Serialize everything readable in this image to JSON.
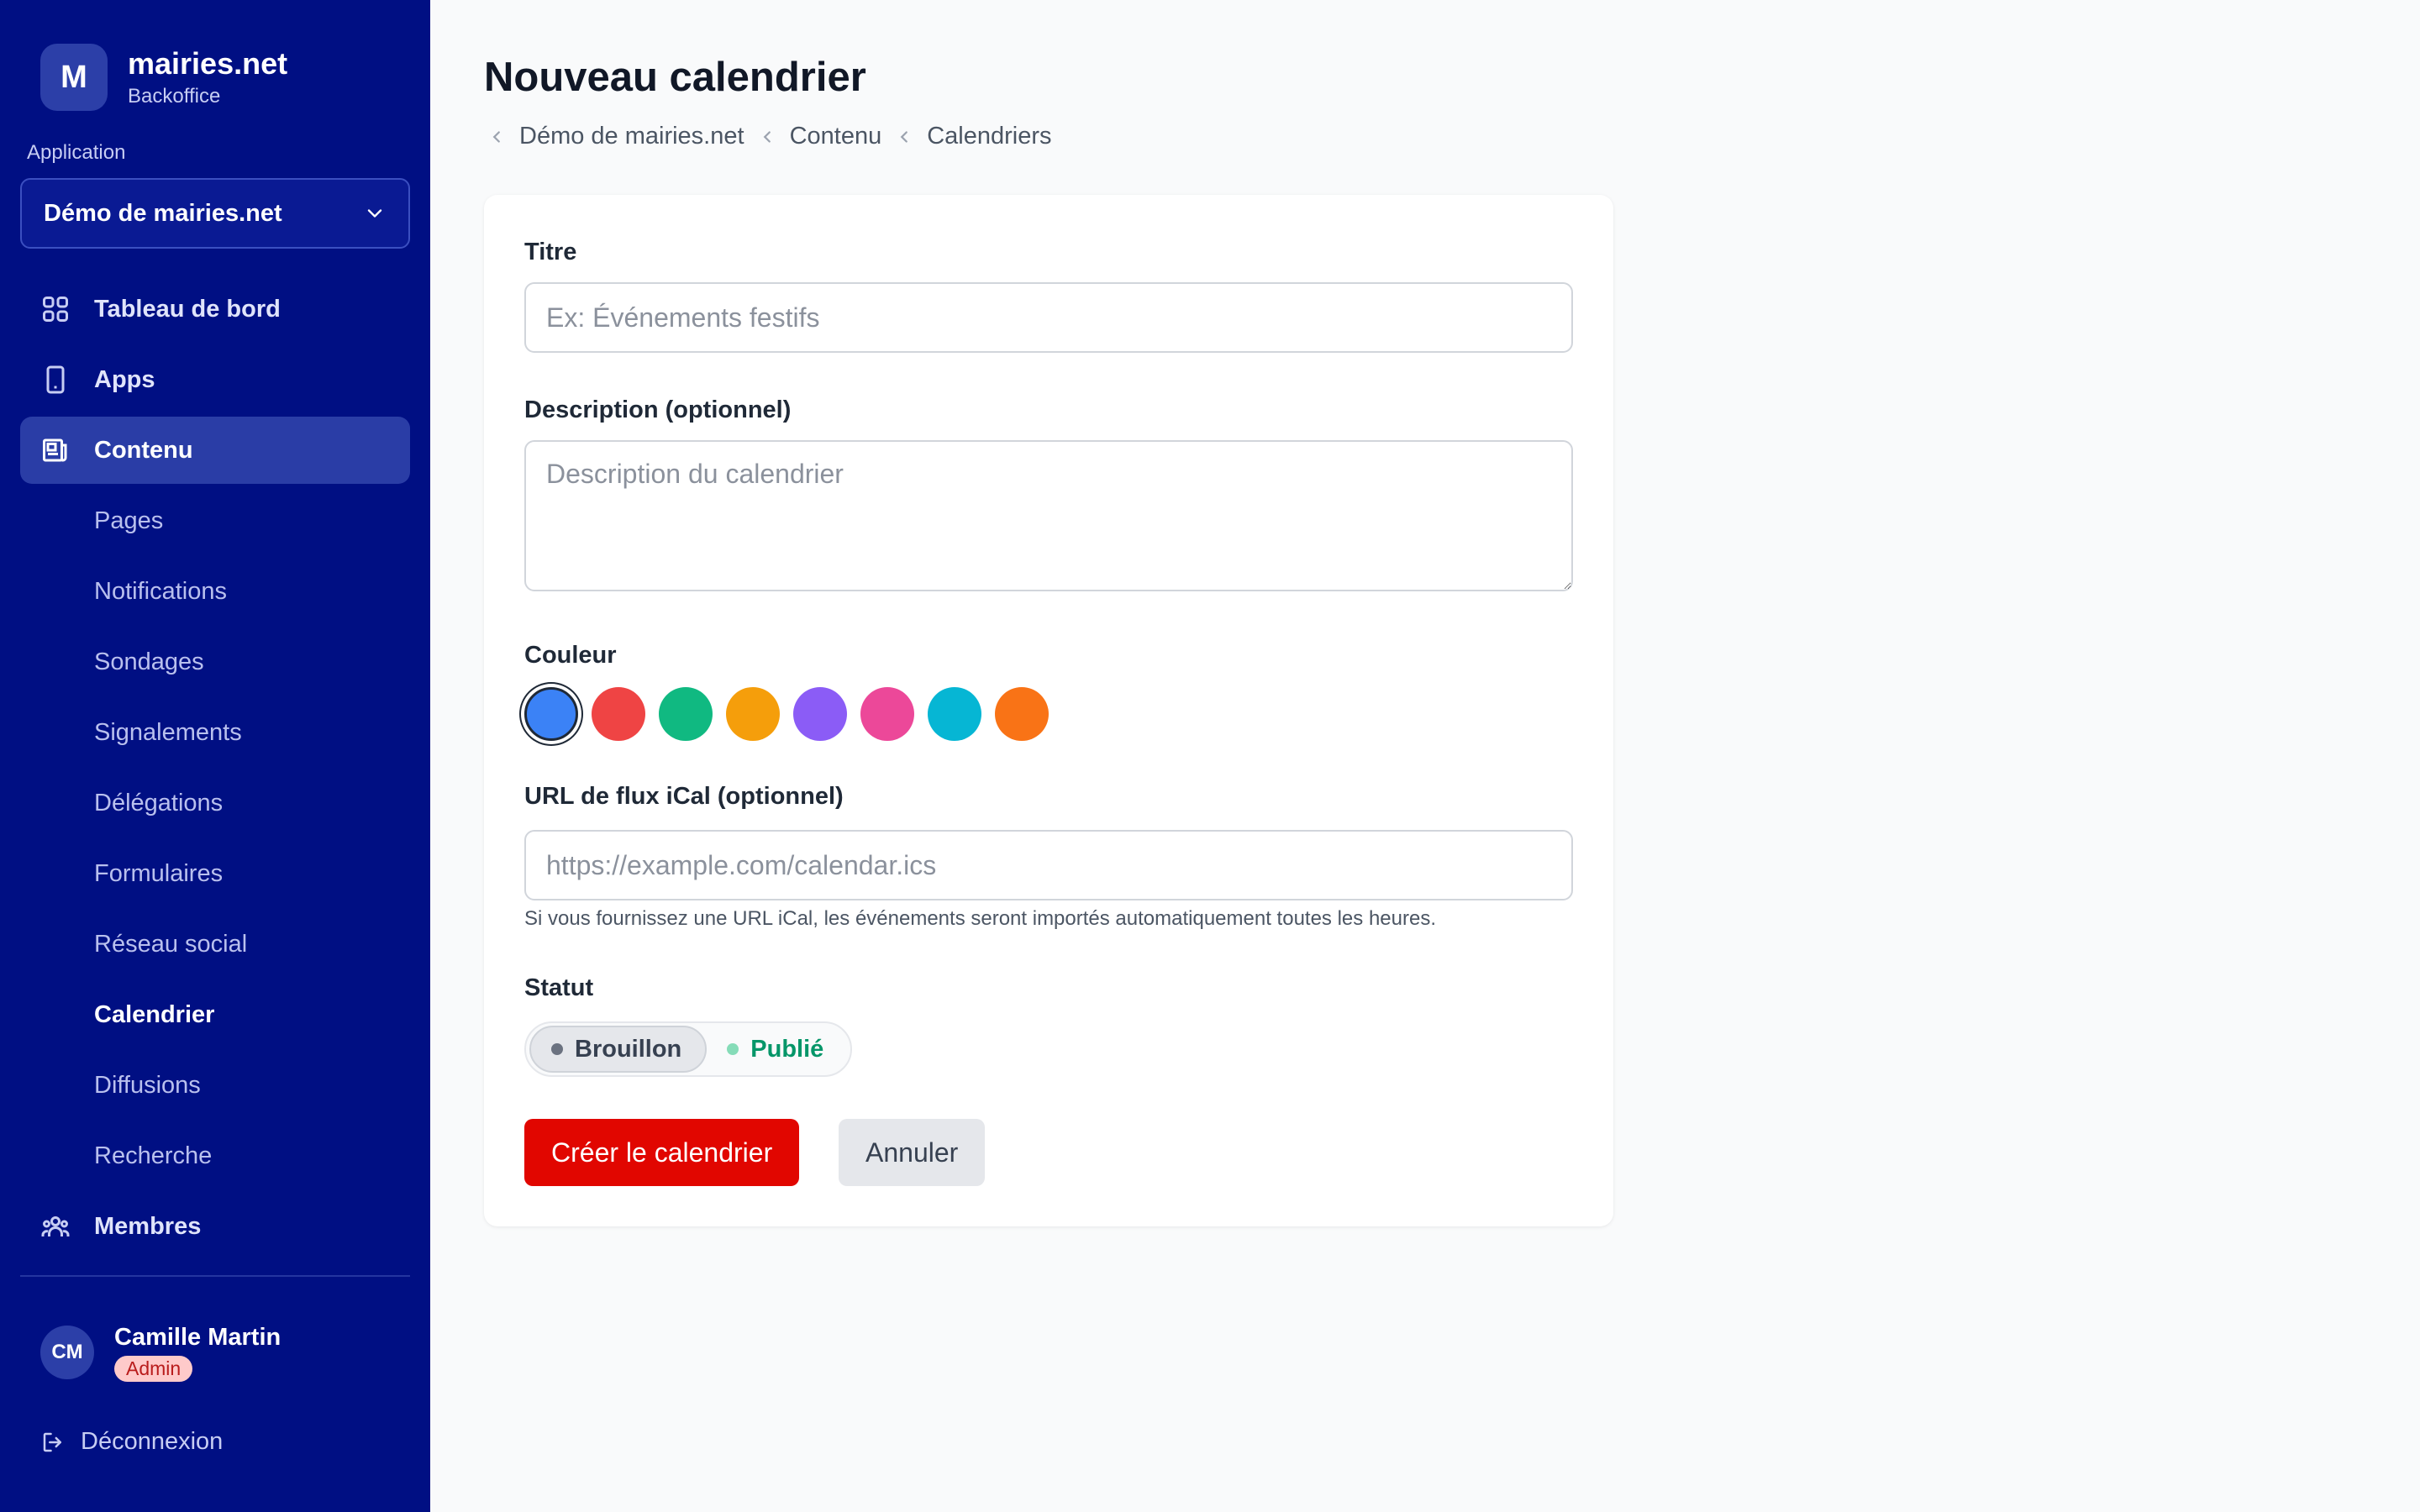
{
  "brand": {
    "logo_letter": "M",
    "name": "mairies.net",
    "subtitle": "Backoffice"
  },
  "app_selector": {
    "label": "Application",
    "value": "Démo de mairies.net"
  },
  "nav": {
    "dashboard": "Tableau de bord",
    "apps": "Apps",
    "content": "Contenu",
    "sub": [
      "Pages",
      "Notifications",
      "Sondages",
      "Signalements",
      "Délégations",
      "Formulaires",
      "Réseau social",
      "Calendrier",
      "Diffusions",
      "Recherche"
    ],
    "members": "Membres"
  },
  "user": {
    "initials": "CM",
    "name": "Camille Martin",
    "role": "Admin"
  },
  "logout": "Déconnexion",
  "page": {
    "title": "Nouveau calendrier",
    "breadcrumb": [
      "Démo de mairies.net",
      "Contenu",
      "Calendriers"
    ]
  },
  "form": {
    "title_label": "Titre",
    "title_placeholder": "Ex: Événements festifs",
    "description_label": "Description (optionnel)",
    "description_placeholder": "Description du calendrier",
    "color_label": "Couleur",
    "colors": [
      "#3b82f6",
      "#ef4444",
      "#10b981",
      "#f59e0b",
      "#8b5cf6",
      "#ec4899",
      "#06b6d4",
      "#f97316"
    ],
    "selected_color": "#3b82f6",
    "ical_label": "URL de flux iCal (optionnel)",
    "ical_placeholder": "https://example.com/calendar.ics",
    "ical_hint": "Si vous fournissez une URL iCal, les événements seront importés automatiquement toutes les heures.",
    "status_label": "Statut",
    "status_options": [
      "Brouillon",
      "Publié"
    ],
    "status_selected": "Brouillon",
    "submit": "Créer le calendrier",
    "cancel": "Annuler"
  }
}
